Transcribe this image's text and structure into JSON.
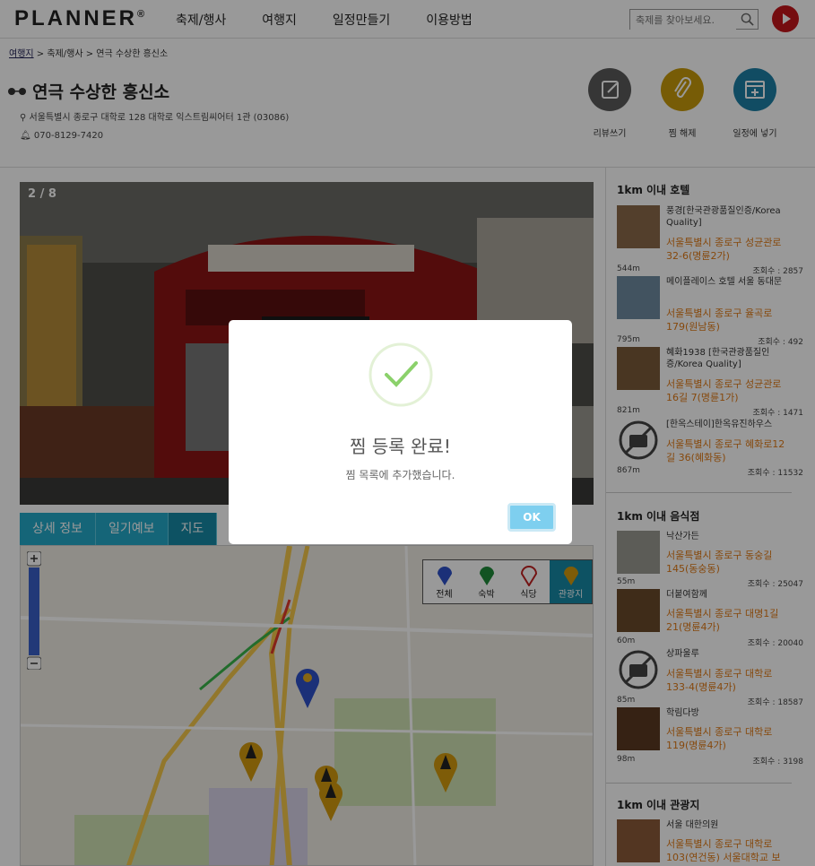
{
  "header": {
    "logo": "PLANNER",
    "logo_mark": "®",
    "nav": [
      "축제/행사",
      "여행지",
      "일정만들기",
      "이용방법"
    ],
    "search_placeholder": "축제를 찾아보세요."
  },
  "breadcrumb": {
    "home": "여행지",
    "rest": " > 축제/행사 > 연극 수상한 흥신소"
  },
  "place": {
    "title": "연극 수상한 흥신소",
    "address": "서울특별시 종로구 대학로 128 대학로 익스트림씨어터 1관 (03086)",
    "phone": "070-8129-7420"
  },
  "actions": [
    {
      "label": "리뷰쓰기",
      "color": "#5b5b5b"
    },
    {
      "label": "찜 해제",
      "color": "#c79a0a"
    },
    {
      "label": "일정에 넣기",
      "color": "#1d7fa5"
    }
  ],
  "gallery": {
    "counter": "2 / 8"
  },
  "tabs": [
    "상세 정보",
    "일기예보",
    "지도"
  ],
  "map_legend": [
    "전체",
    "숙박",
    "식당",
    "관광지"
  ],
  "sidebar": {
    "hotels_title": "1km 이내 호텔",
    "hotels": [
      {
        "name": "풍경[한국관광품질인증/Korea Quality]",
        "addr": "서울특별시 종로구 성균관로 32-6(명륜2가)",
        "dist": "544m",
        "count": "조회수 : 2857"
      },
      {
        "name": "메이플레이스 호텔 서울 동대문",
        "addr": "서울특별시 종로구 율곡로 179(원남동)",
        "dist": "795m",
        "count": "조회수 : 492"
      },
      {
        "name": "혜화1938 [한국관광품질인증/Korea Quality]",
        "addr": "서울특별시 종로구 성균관로16길 7(명륜1가)",
        "dist": "821m",
        "count": "조회수 : 1471"
      },
      {
        "name": "[한옥스테이]한옥유진하우스",
        "addr": "서울특별시 종로구 혜화로12길 36(혜화동)",
        "dist": "867m",
        "count": "조회수 : 11532"
      }
    ],
    "food_title": "1km 이내 음식점",
    "food": [
      {
        "name": "낙산가든",
        "addr": "서울특별시 종로구 동숭길 145(동숭동)",
        "dist": "55m",
        "count": "조회수 : 25047"
      },
      {
        "name": "더붙여함께",
        "addr": "서울특별시 종로구 대명1길 21(명륜4가)",
        "dist": "60m",
        "count": "조회수 : 20040"
      },
      {
        "name": "상파울루",
        "addr": "서울특별시 종로구 대학로 133-4(명륜4가)",
        "dist": "85m",
        "count": "조회수 : 18587"
      },
      {
        "name": "학림다방",
        "addr": "서울특별시 종로구 대학로 119(명륜4가)",
        "dist": "98m",
        "count": "조회수 : 3198"
      }
    ],
    "tour_title": "1km 이내 관광지",
    "tour": [
      {
        "name": "서울 대한의원",
        "addr": "서울특별시 종로구 대학로 103(연건동) 서울대학교 보"
      }
    ]
  },
  "modal": {
    "title": "찜 등록 완료!",
    "message": "찜 목록에 추가했습니다.",
    "ok": "OK"
  }
}
